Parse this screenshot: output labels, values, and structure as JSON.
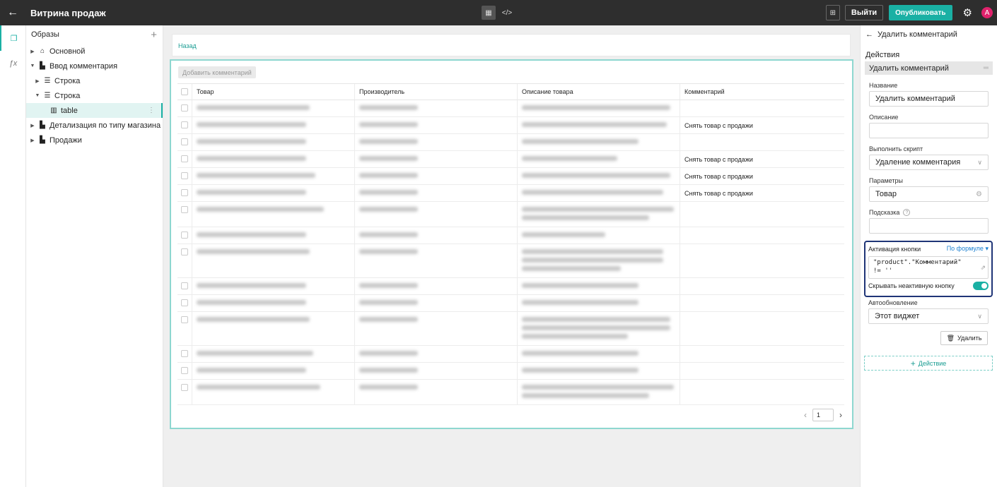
{
  "header": {
    "title": "Витрина продаж",
    "exit_label": "Выйти",
    "publish_label": "Опубликовать",
    "avatar_letter": "A"
  },
  "tree": {
    "title": "Образы",
    "items": [
      {
        "label": "Основной",
        "icon": "home-icon",
        "level": 0,
        "expanded": false
      },
      {
        "label": "Ввод комментария",
        "icon": "layout-icon",
        "level": 0,
        "expanded": true
      },
      {
        "label": "Строка",
        "icon": "row-icon",
        "level": 1,
        "expanded": false
      },
      {
        "label": "Строка",
        "icon": "row-icon",
        "level": 1,
        "expanded": true
      },
      {
        "label": "table",
        "icon": "table-icon",
        "level": 2,
        "selected": true
      },
      {
        "label": "Детализация по типу магазина",
        "icon": "layout-icon",
        "level": 0,
        "expanded": false
      },
      {
        "label": "Продажи",
        "icon": "layout-icon",
        "level": 0,
        "expanded": false
      }
    ]
  },
  "canvas": {
    "back_label": "Назад",
    "add_comment_label": "Добавить комментарий",
    "columns": [
      "Товар",
      "Производитель",
      "Описание товара",
      "Комментарий"
    ],
    "rows": [
      {
        "comment": "",
        "lines": 1
      },
      {
        "comment": "Снять товар с продажи",
        "lines": 1
      },
      {
        "comment": "",
        "lines": 1
      },
      {
        "comment": "Снять товар с продажи",
        "lines": 1
      },
      {
        "comment": "Снять товар с продажи",
        "lines": 1
      },
      {
        "comment": "Снять товар с продажи",
        "lines": 1
      },
      {
        "comment": "",
        "lines": 2
      },
      {
        "comment": "",
        "lines": 1
      },
      {
        "comment": "",
        "lines": 3
      },
      {
        "comment": "",
        "lines": 1
      },
      {
        "comment": "",
        "lines": 1
      },
      {
        "comment": "",
        "lines": 3
      },
      {
        "comment": "",
        "lines": 1
      },
      {
        "comment": "",
        "lines": 1
      },
      {
        "comment": "",
        "lines": 2
      }
    ],
    "page": "1"
  },
  "panel": {
    "header": "Удалить комментарий",
    "actions_title": "Действия",
    "action_item": "Удалить комментарий",
    "name_label": "Название",
    "name_value": "Удалить комментарий",
    "description_label": "Описание",
    "description_value": "",
    "script_label": "Выполнить скрипт",
    "script_value": "Удаление комментария",
    "params_label": "Параметры",
    "params_value": "Товар",
    "hint_label": "Подсказка",
    "hint_value": "",
    "activation_label": "Активация кнопки",
    "activation_mode": "По формуле",
    "formula_line1": "\"product\".\"Комментарий\"",
    "formula_line2": "!= ''",
    "hide_inactive_label": "Скрывать неактивную кнопку",
    "hide_inactive_on": true,
    "autoupdate_label": "Автообновление",
    "autoupdate_value": "Этот виджет",
    "delete_label": "Удалить",
    "add_action_label": "Действие"
  },
  "colors": {
    "accent": "#1ab0a4",
    "topbar": "#2e2e2e",
    "highlight": "#1f3577",
    "link": "#1a7fd0"
  }
}
